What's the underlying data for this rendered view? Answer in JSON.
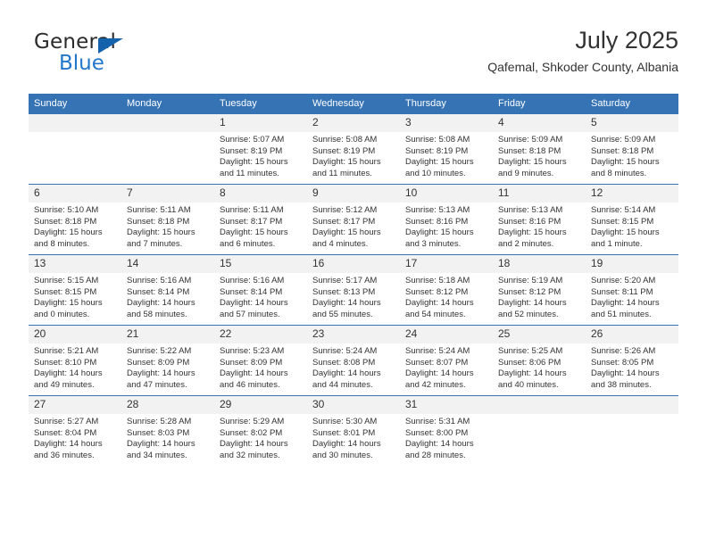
{
  "logo": {
    "text_primary": "General",
    "text_secondary": "Blue",
    "triangle_icon": "triangle-icon",
    "color_primary": "#2b2b2b",
    "color_secondary": "#2277cc",
    "color_triangle": "#1461ac"
  },
  "header": {
    "title": "July 2025",
    "subtitle": "Qafemal, Shkoder County, Albania"
  },
  "theme": {
    "header_blue": "#3573b5",
    "daynum_band": "#f2f2f2",
    "text": "#333333"
  },
  "calendar": {
    "weekday_headers": [
      "Sunday",
      "Monday",
      "Tuesday",
      "Wednesday",
      "Thursday",
      "Friday",
      "Saturday"
    ],
    "weeks": [
      [
        {
          "day": "",
          "lines": []
        },
        {
          "day": "",
          "lines": []
        },
        {
          "day": "1",
          "lines": [
            "Sunrise: 5:07 AM",
            "Sunset: 8:19 PM",
            "Daylight: 15 hours",
            "and 11 minutes."
          ]
        },
        {
          "day": "2",
          "lines": [
            "Sunrise: 5:08 AM",
            "Sunset: 8:19 PM",
            "Daylight: 15 hours",
            "and 11 minutes."
          ]
        },
        {
          "day": "3",
          "lines": [
            "Sunrise: 5:08 AM",
            "Sunset: 8:19 PM",
            "Daylight: 15 hours",
            "and 10 minutes."
          ]
        },
        {
          "day": "4",
          "lines": [
            "Sunrise: 5:09 AM",
            "Sunset: 8:18 PM",
            "Daylight: 15 hours",
            "and 9 minutes."
          ]
        },
        {
          "day": "5",
          "lines": [
            "Sunrise: 5:09 AM",
            "Sunset: 8:18 PM",
            "Daylight: 15 hours",
            "and 8 minutes."
          ]
        }
      ],
      [
        {
          "day": "6",
          "lines": [
            "Sunrise: 5:10 AM",
            "Sunset: 8:18 PM",
            "Daylight: 15 hours",
            "and 8 minutes."
          ]
        },
        {
          "day": "7",
          "lines": [
            "Sunrise: 5:11 AM",
            "Sunset: 8:18 PM",
            "Daylight: 15 hours",
            "and 7 minutes."
          ]
        },
        {
          "day": "8",
          "lines": [
            "Sunrise: 5:11 AM",
            "Sunset: 8:17 PM",
            "Daylight: 15 hours",
            "and 6 minutes."
          ]
        },
        {
          "day": "9",
          "lines": [
            "Sunrise: 5:12 AM",
            "Sunset: 8:17 PM",
            "Daylight: 15 hours",
            "and 4 minutes."
          ]
        },
        {
          "day": "10",
          "lines": [
            "Sunrise: 5:13 AM",
            "Sunset: 8:16 PM",
            "Daylight: 15 hours",
            "and 3 minutes."
          ]
        },
        {
          "day": "11",
          "lines": [
            "Sunrise: 5:13 AM",
            "Sunset: 8:16 PM",
            "Daylight: 15 hours",
            "and 2 minutes."
          ]
        },
        {
          "day": "12",
          "lines": [
            "Sunrise: 5:14 AM",
            "Sunset: 8:15 PM",
            "Daylight: 15 hours",
            "and 1 minute."
          ]
        }
      ],
      [
        {
          "day": "13",
          "lines": [
            "Sunrise: 5:15 AM",
            "Sunset: 8:15 PM",
            "Daylight: 15 hours",
            "and 0 minutes."
          ]
        },
        {
          "day": "14",
          "lines": [
            "Sunrise: 5:16 AM",
            "Sunset: 8:14 PM",
            "Daylight: 14 hours",
            "and 58 minutes."
          ]
        },
        {
          "day": "15",
          "lines": [
            "Sunrise: 5:16 AM",
            "Sunset: 8:14 PM",
            "Daylight: 14 hours",
            "and 57 minutes."
          ]
        },
        {
          "day": "16",
          "lines": [
            "Sunrise: 5:17 AM",
            "Sunset: 8:13 PM",
            "Daylight: 14 hours",
            "and 55 minutes."
          ]
        },
        {
          "day": "17",
          "lines": [
            "Sunrise: 5:18 AM",
            "Sunset: 8:12 PM",
            "Daylight: 14 hours",
            "and 54 minutes."
          ]
        },
        {
          "day": "18",
          "lines": [
            "Sunrise: 5:19 AM",
            "Sunset: 8:12 PM",
            "Daylight: 14 hours",
            "and 52 minutes."
          ]
        },
        {
          "day": "19",
          "lines": [
            "Sunrise: 5:20 AM",
            "Sunset: 8:11 PM",
            "Daylight: 14 hours",
            "and 51 minutes."
          ]
        }
      ],
      [
        {
          "day": "20",
          "lines": [
            "Sunrise: 5:21 AM",
            "Sunset: 8:10 PM",
            "Daylight: 14 hours",
            "and 49 minutes."
          ]
        },
        {
          "day": "21",
          "lines": [
            "Sunrise: 5:22 AM",
            "Sunset: 8:09 PM",
            "Daylight: 14 hours",
            "and 47 minutes."
          ]
        },
        {
          "day": "22",
          "lines": [
            "Sunrise: 5:23 AM",
            "Sunset: 8:09 PM",
            "Daylight: 14 hours",
            "and 46 minutes."
          ]
        },
        {
          "day": "23",
          "lines": [
            "Sunrise: 5:24 AM",
            "Sunset: 8:08 PM",
            "Daylight: 14 hours",
            "and 44 minutes."
          ]
        },
        {
          "day": "24",
          "lines": [
            "Sunrise: 5:24 AM",
            "Sunset: 8:07 PM",
            "Daylight: 14 hours",
            "and 42 minutes."
          ]
        },
        {
          "day": "25",
          "lines": [
            "Sunrise: 5:25 AM",
            "Sunset: 8:06 PM",
            "Daylight: 14 hours",
            "and 40 minutes."
          ]
        },
        {
          "day": "26",
          "lines": [
            "Sunrise: 5:26 AM",
            "Sunset: 8:05 PM",
            "Daylight: 14 hours",
            "and 38 minutes."
          ]
        }
      ],
      [
        {
          "day": "27",
          "lines": [
            "Sunrise: 5:27 AM",
            "Sunset: 8:04 PM",
            "Daylight: 14 hours",
            "and 36 minutes."
          ]
        },
        {
          "day": "28",
          "lines": [
            "Sunrise: 5:28 AM",
            "Sunset: 8:03 PM",
            "Daylight: 14 hours",
            "and 34 minutes."
          ]
        },
        {
          "day": "29",
          "lines": [
            "Sunrise: 5:29 AM",
            "Sunset: 8:02 PM",
            "Daylight: 14 hours",
            "and 32 minutes."
          ]
        },
        {
          "day": "30",
          "lines": [
            "Sunrise: 5:30 AM",
            "Sunset: 8:01 PM",
            "Daylight: 14 hours",
            "and 30 minutes."
          ]
        },
        {
          "day": "31",
          "lines": [
            "Sunrise: 5:31 AM",
            "Sunset: 8:00 PM",
            "Daylight: 14 hours",
            "and 28 minutes."
          ]
        },
        {
          "day": "",
          "lines": []
        },
        {
          "day": "",
          "lines": []
        }
      ]
    ]
  }
}
